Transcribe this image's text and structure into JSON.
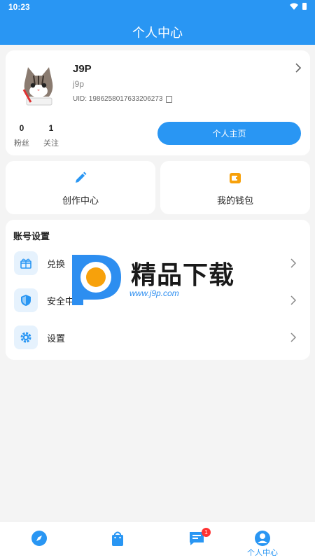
{
  "status_bar": {
    "time": "10:23"
  },
  "header": {
    "title": "个人中心"
  },
  "profile": {
    "username": "J9P",
    "handle": "j9p",
    "uid": "UID: 1986258017633206273",
    "stats": [
      {
        "value": "0",
        "label": "粉丝"
      },
      {
        "value": "1",
        "label": "关注"
      }
    ],
    "homepage_button": "个人主页"
  },
  "quick_actions": [
    {
      "label": "创作中心",
      "icon": "pencil-icon"
    },
    {
      "label": "我的钱包",
      "icon": "wallet-icon"
    }
  ],
  "account_settings": {
    "title": "账号设置",
    "items": [
      {
        "label": "兑换",
        "icon": "gift-icon"
      },
      {
        "label": "安全中心",
        "icon": "shield-icon"
      },
      {
        "label": "设置",
        "icon": "gear-icon"
      }
    ]
  },
  "watermark": {
    "title": "精品下载",
    "url": "www.j9p.com"
  },
  "tab_bar": {
    "tabs": [
      {
        "icon": "compass-icon",
        "label": ""
      },
      {
        "icon": "shopping-bag-icon",
        "label": ""
      },
      {
        "icon": "message-icon",
        "label": "",
        "badge": "1"
      },
      {
        "icon": "profile-icon",
        "label": "个人中心"
      }
    ]
  },
  "colors": {
    "primary": "#2996f3",
    "wallet_accent": "#f7a10b",
    "background": "#f4f4f4"
  }
}
